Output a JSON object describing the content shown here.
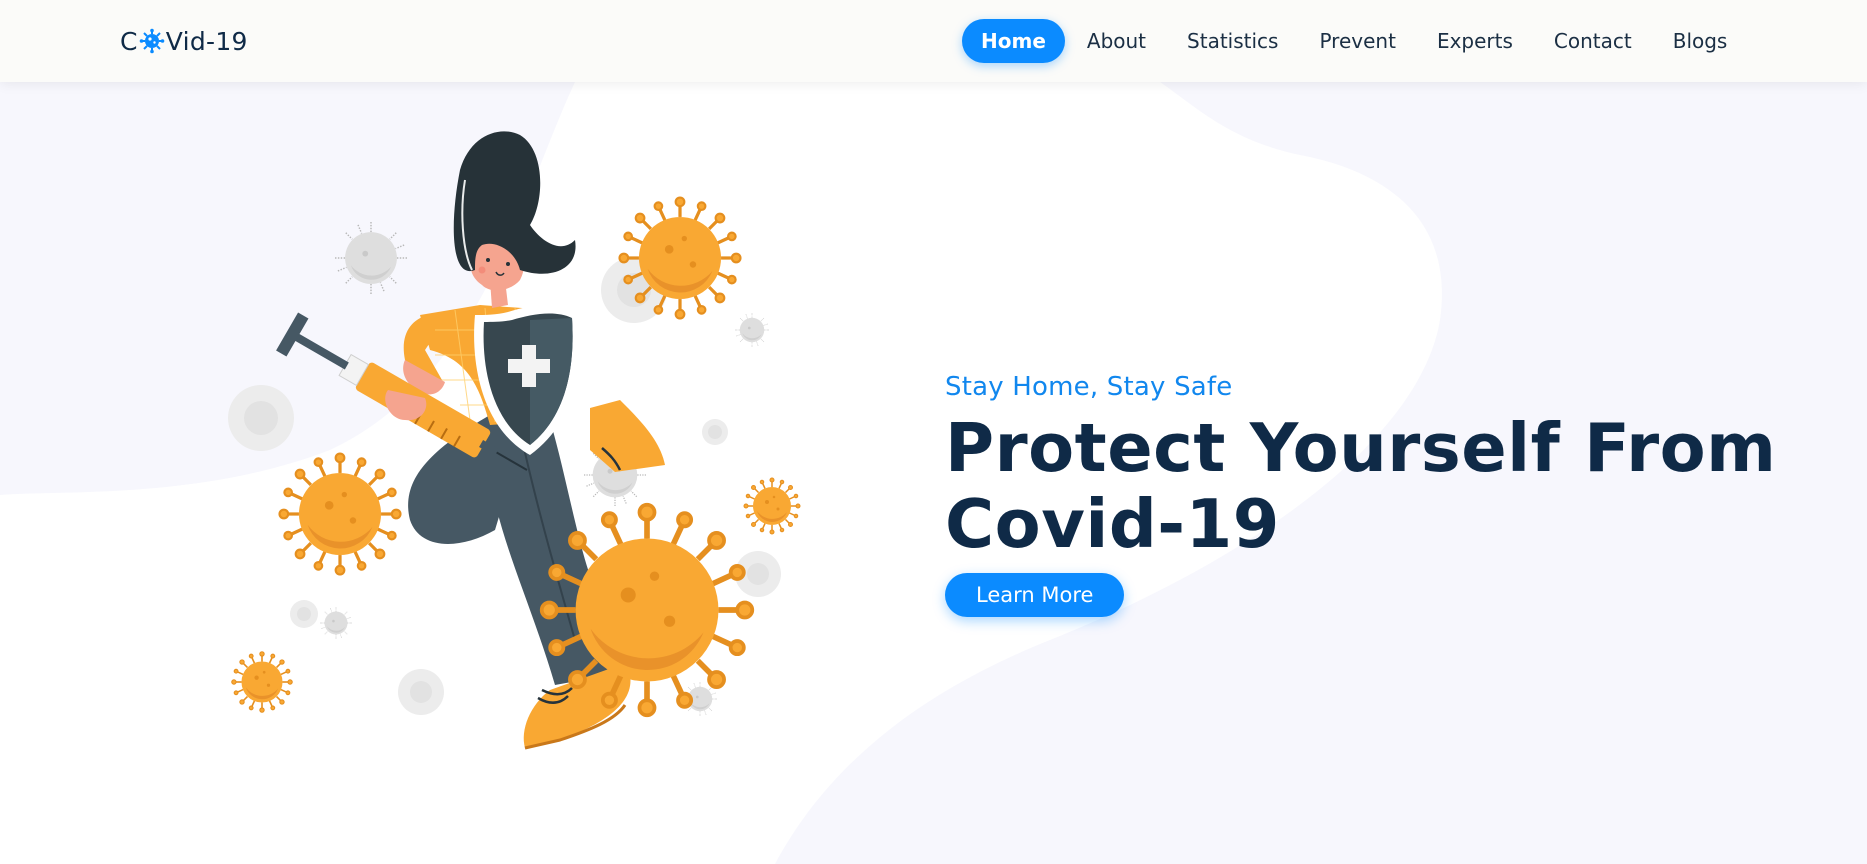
{
  "brand": {
    "prefix": "C",
    "suffix": "Vid-19",
    "icon": "virus-icon",
    "icon_color": "#0b8bff"
  },
  "nav": {
    "items": [
      {
        "label": "Home",
        "active": true
      },
      {
        "label": "About",
        "active": false
      },
      {
        "label": "Statistics",
        "active": false
      },
      {
        "label": "Prevent",
        "active": false
      },
      {
        "label": "Experts",
        "active": false
      },
      {
        "label": "Contact",
        "active": false
      },
      {
        "label": "Blogs",
        "active": false
      }
    ]
  },
  "hero": {
    "tagline": "Stay Home, Stay Safe",
    "headline_line1": "Protect Yourself From",
    "headline_line2": "Covid-19",
    "cta_label": "Learn More",
    "illustration": "woman-with-shield-and-syringe-fighting-virus"
  },
  "colors": {
    "accent": "#0b8bff",
    "heading": "#0f2a47",
    "tagline": "#1187ee",
    "virus_orange": "#f9a833",
    "virus_grey": "#d9d9d9",
    "background_light": "#f7f7fd"
  }
}
